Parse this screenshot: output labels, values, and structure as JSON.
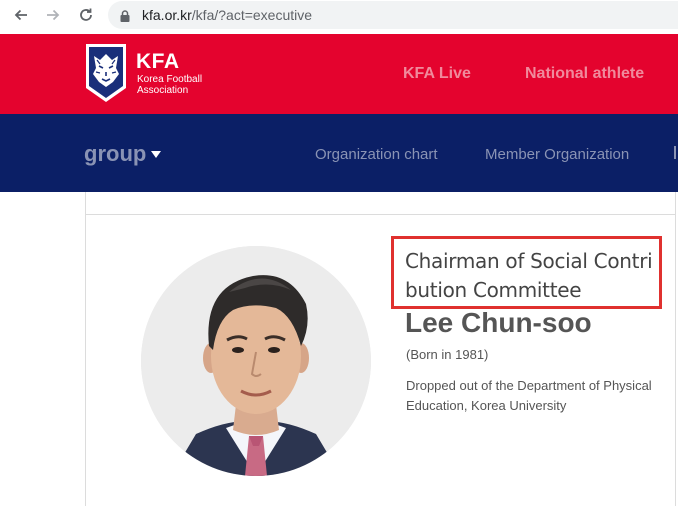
{
  "browser": {
    "url_host": "kfa.or.kr",
    "url_path": "/kfa/?act=executive"
  },
  "header": {
    "logo_title": "KFA",
    "logo_subtitle_line1": "Korea Football",
    "logo_subtitle_line2": "Association",
    "nav_items": [
      "KFA Live",
      "National athlete"
    ]
  },
  "subnav": {
    "group_label": "group",
    "items": [
      "Organization chart",
      "Member Organization"
    ]
  },
  "profile": {
    "position_line1": "Chairman of Social Contri",
    "position_line2": "bution Committee",
    "name": "Lee Chun-soo",
    "born": "(Born in 1981)",
    "education": "Dropped out of the Department of Physical Education, Korea University"
  },
  "colors": {
    "brand_red": "#e4032e",
    "navy": "#0b1f66",
    "highlight_box": "#e0312f"
  }
}
